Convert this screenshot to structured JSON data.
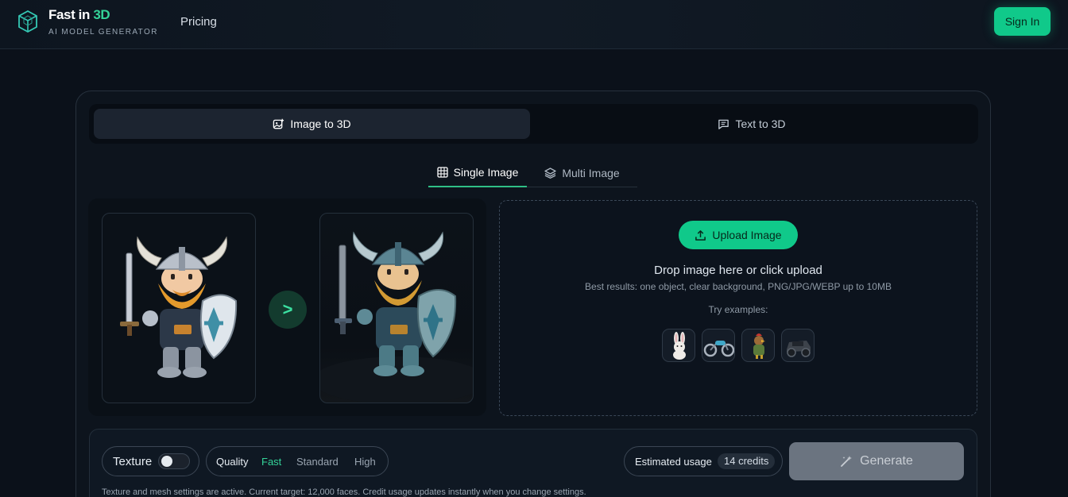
{
  "header": {
    "brand_main": "Fast in ",
    "brand_accent": "3D",
    "brand_sub": "AI MODEL GENERATOR",
    "nav_pricing": "Pricing",
    "signin_label": "Sign In",
    "logo_icon": "cube-logo-icon"
  },
  "mode_tabs": [
    {
      "label": "Image to 3D",
      "icon": "image-plus-icon",
      "active": true
    },
    {
      "label": "Text to 3D",
      "icon": "message-square-icon",
      "active": false
    }
  ],
  "sub_tabs": [
    {
      "label": "Single Image",
      "icon": "grid-icon",
      "active": true
    },
    {
      "label": "Multi Image",
      "icon": "layers-icon",
      "active": false
    }
  ],
  "preview": {
    "arrow_label": ">",
    "input_image": "viking-warrior-2d-illustration",
    "output_image": "viking-warrior-3d-render"
  },
  "upload": {
    "button_label": "Upload Image",
    "button_icon": "upload-icon",
    "title": "Drop image here or click upload",
    "hint": "Best results: one object, clear background, PNG/JPG/WEBP up to 10MB",
    "try_label": "Try examples:",
    "examples": [
      "rabbit-example",
      "motorcycle-example",
      "knight-chicken-example",
      "offroad-vehicle-example"
    ]
  },
  "settings": {
    "texture_label": "Texture",
    "texture_enabled": false,
    "quality_label": "Quality",
    "quality_options": [
      "Fast",
      "Standard",
      "High"
    ],
    "quality_selected": "Fast",
    "usage_label": "Estimated usage",
    "credits_label": "14 credits",
    "generate_label": "Generate",
    "generate_icon": "magic-wand-icon",
    "footnote": "Texture and mesh settings are active. Current target: 12,000 faces. Credit usage updates instantly when you change settings."
  },
  "colors": {
    "accent": "#10c98a",
    "accent_text": "#34d399",
    "background": "#0b111a",
    "card": "#0d141d",
    "generate_disabled": "#6b7480"
  }
}
